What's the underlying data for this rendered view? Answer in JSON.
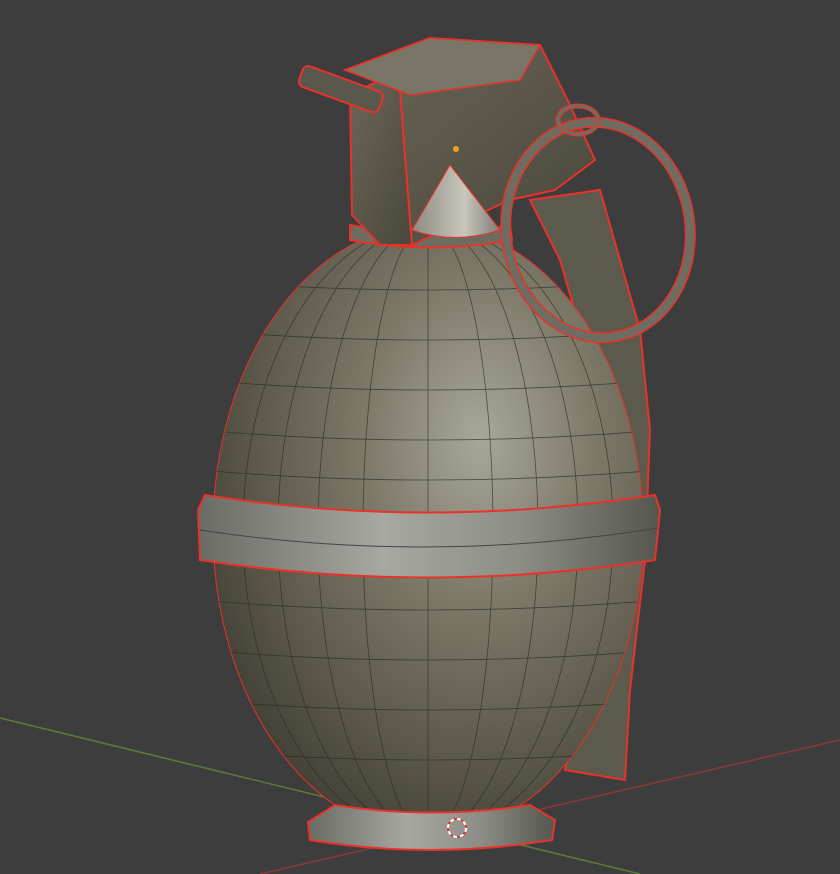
{
  "viewport": {
    "background_color": "#3d3d3d",
    "selection_outline_color": "#e8322a",
    "x_axis_color": "#8a3a3a",
    "y_axis_color": "#5e7a3a",
    "origin_color": "#f0a020"
  },
  "scene": {
    "object_icon": "grenade-mesh",
    "cursor_icon": "3d-cursor-icon"
  }
}
